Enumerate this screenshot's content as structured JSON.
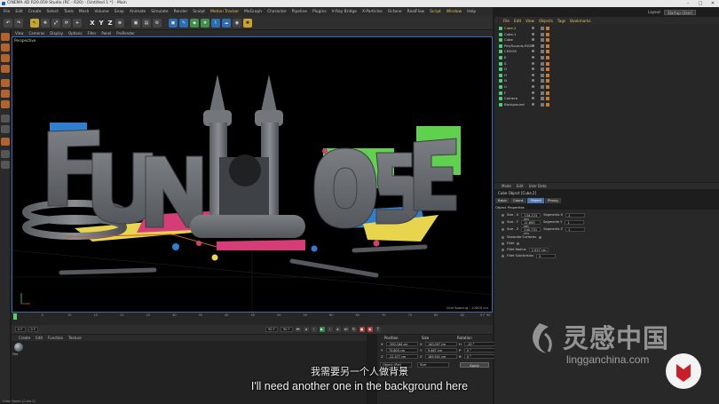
{
  "window": {
    "title": "CINEMA 4D R20.059 Studio (RC - R20) - [Untitled 1 *] - Main"
  },
  "menu": {
    "items": [
      "File",
      "Edit",
      "Create",
      "Select",
      "Tools",
      "Mesh",
      "Volume",
      "Snap",
      "Animate",
      "Simulate",
      "Render",
      "Sculpt",
      "Motion Tracker",
      "MoGraph",
      "Character",
      "Pipeline",
      "Plugins",
      "V-Ray Bridge",
      "X-Particles",
      "Octane",
      "RealFlow",
      "Script",
      "Window",
      "Help"
    ],
    "highlighted": [
      "Motion Tracker",
      "Script",
      "Window"
    ]
  },
  "layout": {
    "label": "Layout:",
    "value": "Startup (User)"
  },
  "toolbar": {
    "axis_x": "X",
    "axis_y": "Y",
    "axis_z": "Z"
  },
  "viewport": {
    "menu": [
      "View",
      "Cameras",
      "Display",
      "Options",
      "Filter",
      "Panel",
      "ProRender"
    ],
    "label": "Perspective",
    "grid_spacing": "Grid Spacing : 10000 cm",
    "accent_color": "#3b6db3"
  },
  "timeline": {
    "ticks": [
      "0",
      "5",
      "10",
      "15",
      "20",
      "25",
      "30",
      "35",
      "40",
      "45",
      "50",
      "55",
      "60",
      "65",
      "70",
      "75",
      "80",
      "85",
      "90"
    ],
    "end_label": "0 F",
    "fields": {
      "start": "0 F",
      "current": "0 F",
      "end": "90 F",
      "max": "90 F"
    }
  },
  "material_manager": {
    "menu": [
      "Create",
      "Edit",
      "Function",
      "Texture"
    ],
    "material_label": "Mat"
  },
  "coordinates": {
    "headers": {
      "position": "Position",
      "size": "Size",
      "rotation": "Rotation"
    },
    "rows": [
      {
        "axis": "X",
        "pos": "-390.184 cm",
        "size": "140.007 cm",
        "rot_label": "H",
        "rot": "-10 °"
      },
      {
        "axis": "Y",
        "pos": "73.803 cm",
        "size": "9.467 cm",
        "rot_label": "P",
        "rot": "0 °"
      },
      {
        "axis": "Z",
        "pos": "-22.077 cm",
        "size": "189.501 cm",
        "rot_label": "B",
        "rot": "0 °"
      }
    ],
    "mode_object": "Object (Rel)",
    "mode_size": "Size",
    "apply_label": "Apply"
  },
  "object_manager": {
    "menu": [
      "File",
      "Edit",
      "View",
      "Objects",
      "Tags",
      "Bookmarks"
    ],
    "objects": [
      {
        "name": "Cube.2",
        "selected": true
      },
      {
        "name": "Cube.1",
        "selected": false
      },
      {
        "name": "Cube",
        "selected": false
      },
      {
        "name": "PolySounds-RGG",
        "selected": false
      },
      {
        "name": "CHOOS",
        "selected": false
      },
      {
        "name": "E",
        "selected": false
      },
      {
        "name": "S",
        "selected": false
      },
      {
        "name": "O",
        "selected": false
      },
      {
        "name": "H",
        "selected": false
      },
      {
        "name": "N",
        "selected": false
      },
      {
        "name": "U",
        "selected": false
      },
      {
        "name": "F",
        "selected": false
      },
      {
        "name": "Camera",
        "selected": false
      },
      {
        "name": "Background",
        "selected": false
      }
    ]
  },
  "attribute_manager": {
    "menu": [
      "Mode",
      "Edit",
      "User Data"
    ],
    "title": "Cube Object [Cube.2]",
    "tabs": [
      "Basic",
      "Coord.",
      "Object",
      "Phong"
    ],
    "active_tab": "Object",
    "section": "Object Properties",
    "rows": [
      {
        "label": "Size . X",
        "value": "134.223 cm",
        "seg_label": "Segments X",
        "seg": "1"
      },
      {
        "label": "Size . Y",
        "value": "11.693 cm",
        "seg_label": "Segments Y",
        "seg": "1"
      },
      {
        "label": "Size . Z",
        "value": "240.751 cm",
        "seg_label": "Segments Z",
        "seg": "1"
      }
    ],
    "extra": [
      {
        "label": "Separate Surfaces",
        "value": ""
      },
      {
        "label": "Fillet",
        "value": ""
      },
      {
        "label": "Fillet Radius",
        "value": "2.027 cm"
      },
      {
        "label": "Fillet Subdivision",
        "value": "5"
      }
    ]
  },
  "subtitles": {
    "chinese": "我需要另一个人做背景",
    "english": "I'll need another one in the background here"
  },
  "watermark": {
    "brand_cn": "灵感中国",
    "url": "lingganchina.com"
  },
  "status": {
    "text": "Cube Object [Cube.2]"
  },
  "scene": {
    "letters": [
      "F",
      "U",
      "N",
      "H",
      "O",
      "U",
      "S",
      "E"
    ]
  }
}
